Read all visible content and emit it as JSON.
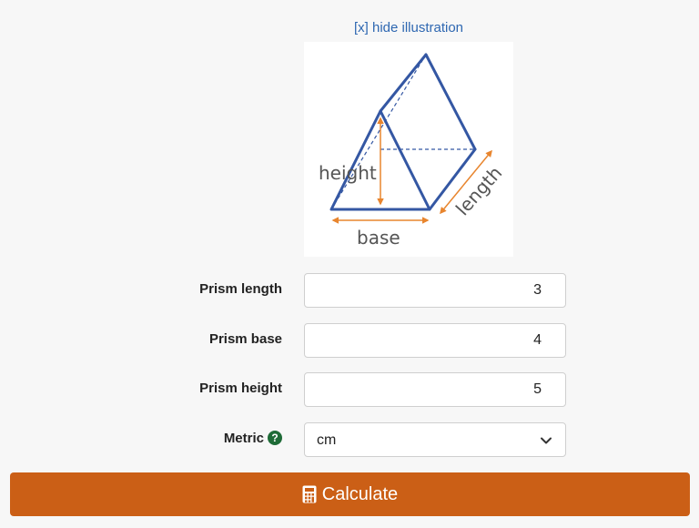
{
  "illustration": {
    "toggle_label": "[x] hide illustration",
    "labels": {
      "height": "height",
      "base": "base",
      "length": "length"
    }
  },
  "form": {
    "fields": [
      {
        "label": "Prism length",
        "value": "3"
      },
      {
        "label": "Prism base",
        "value": "4"
      },
      {
        "label": "Prism height",
        "value": "5"
      }
    ],
    "metric": {
      "label": "Metric",
      "help_icon": "?",
      "selected": "cm"
    }
  },
  "actions": {
    "calculate_label": "Calculate"
  },
  "colors": {
    "prism_edge": "#3457a3",
    "dimension_arrow": "#e8852e",
    "link": "#2e67b1",
    "button": "#cb5f16",
    "help_badge": "#1e6b37"
  },
  "icons": {
    "help": "question-circle-icon",
    "dropdown": "chevron-down-icon",
    "calculate": "calculator-icon"
  }
}
